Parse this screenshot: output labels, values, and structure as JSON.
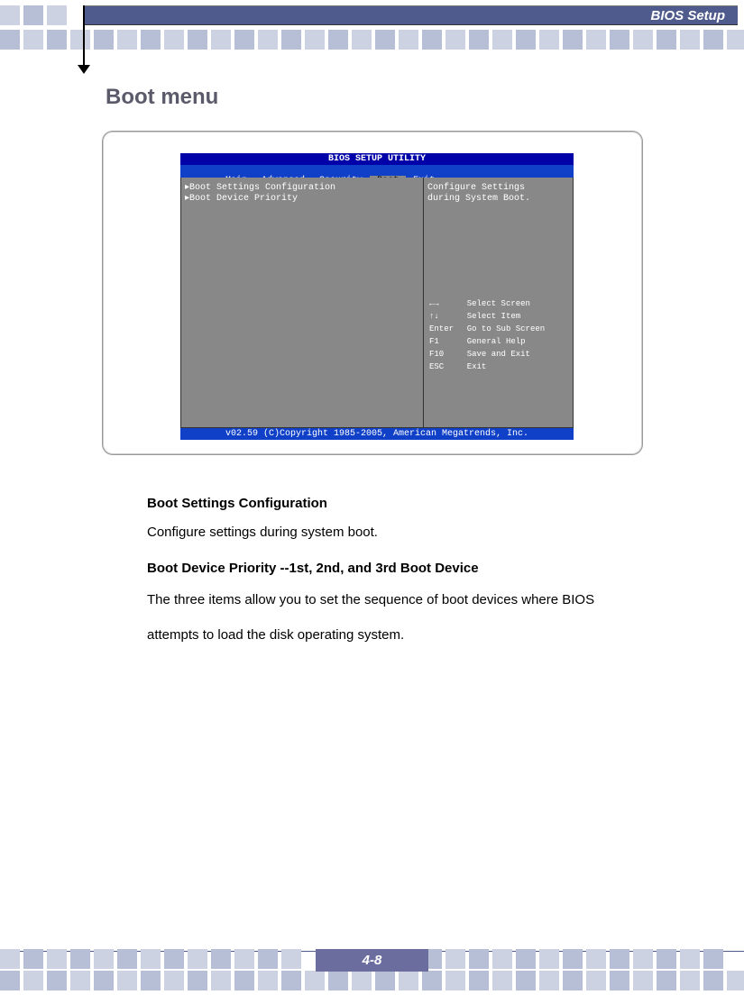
{
  "header": {
    "title": "BIOS Setup"
  },
  "section": {
    "title": "Boot menu"
  },
  "bios": {
    "utility_title": "BIOS SETUP UTILITY",
    "tabs": {
      "main": "Main",
      "advanced": "Advanced",
      "security": "Security",
      "boot": "Boot",
      "exit": "Exit"
    },
    "left_items": {
      "item1": "Boot Settings Configuration",
      "item2": "Boot Device Priority"
    },
    "help": {
      "line1": "Configure Settings",
      "line2": "during System Boot."
    },
    "keys": {
      "k1a": "←→",
      "k1b": "Select Screen",
      "k2a": "↑↓",
      "k2b": "Select Item",
      "k3a": "Enter",
      "k3b": "Go to Sub Screen",
      "k4a": "F1",
      "k4b": "General Help",
      "k5a": "F10",
      "k5b": "Save and Exit",
      "k6a": "ESC",
      "k6b": "Exit"
    },
    "footer": "v02.59 (C)Copyright 1985-2005, American Megatrends, Inc."
  },
  "body": {
    "h1": "Boot Settings Configuration",
    "p1": "Configure settings during system boot.",
    "h2": "Boot Device Priority --1st, 2nd, and 3rd Boot Device",
    "p2": "The three items allow you to set the sequence of boot devices where BIOS",
    "p3": "attempts to load the disk operating system."
  },
  "footer": {
    "page": "4-8"
  }
}
